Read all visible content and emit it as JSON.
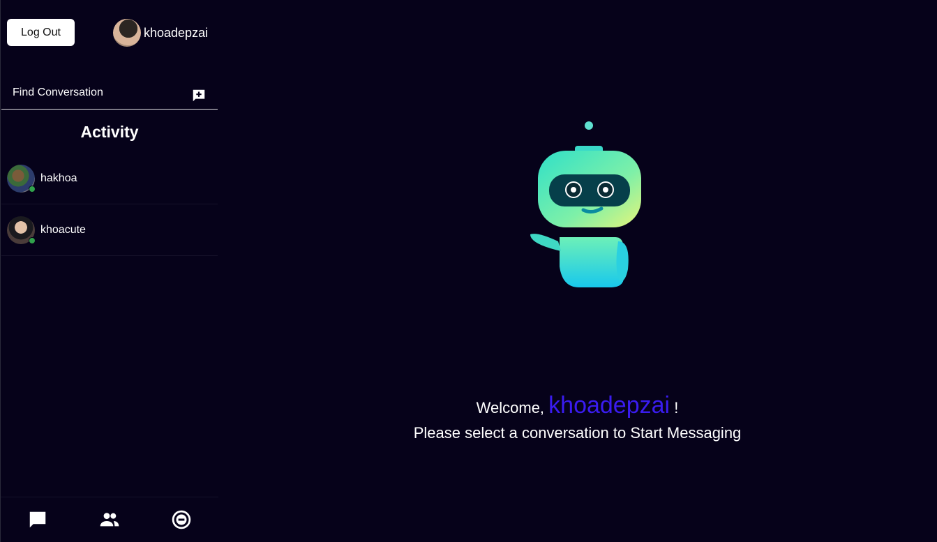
{
  "header": {
    "logout_label": "Log Out",
    "current_user": "khoadepzai"
  },
  "search": {
    "label": "Find Conversation"
  },
  "activity": {
    "title": "Activity",
    "conversations": [
      {
        "name": "hakhoa",
        "online": true
      },
      {
        "name": "khoacute",
        "online": true
      }
    ]
  },
  "bottom_nav": {
    "items": [
      {
        "icon": "chat-bubble-icon"
      },
      {
        "icon": "people-icon"
      },
      {
        "icon": "minus-circle-icon"
      }
    ]
  },
  "main": {
    "welcome_prefix": "Welcome,",
    "welcome_username": "khoadepzai",
    "welcome_suffix": "!",
    "subtitle": "Please select a conversation to Start Messaging"
  },
  "colors": {
    "background": "#06021a",
    "accent": "#3a1cf0",
    "online": "#31a24c"
  }
}
